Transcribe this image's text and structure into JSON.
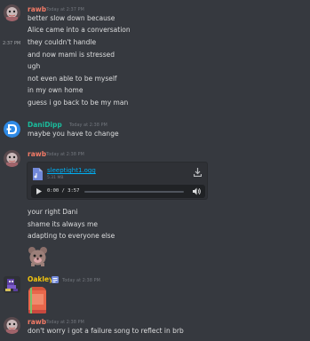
{
  "messages": [
    {
      "username": "rawb",
      "user_color": "#f47b67",
      "timestamp": "Today at 2:37 PM",
      "hover_timestamp": "2:37 PM",
      "lines": [
        "better slow down because",
        "Alice came into a conversation",
        "they couldn't handle",
        "and now mami is stressed",
        "ugh",
        "not even able to be myself",
        "in my own home",
        "guess i go back to be my man"
      ]
    },
    {
      "username": "DaniDipp",
      "user_color": "#1abc9c",
      "timestamp": "Today at 2:38 PM",
      "lines": [
        "maybe you have to change"
      ]
    },
    {
      "username": "rawb",
      "user_color": "#f47b67",
      "timestamp": "Today at 2:38 PM",
      "attachment": {
        "file_name": "sleeptight1.ogg",
        "file_size": "5.31 MB",
        "time": "0:00 / 3:57"
      },
      "lines": [
        "your right Dani",
        "shame its always me",
        "adapting to everyone else"
      ],
      "sticker": "bear-sticker"
    },
    {
      "username": "Oakley",
      "user_color": "#f1c40f",
      "timestamp": "Today at 2:38 PM"
    },
    {
      "username": "rawb",
      "user_color": "#f47b67",
      "timestamp": "Today at 2:38 PM",
      "lines": [
        "don't worry i got a failure song to reflect in brb"
      ]
    }
  ],
  "colors": {
    "background": "#36393f",
    "link": "#00b0f4",
    "muted": "#72767d"
  }
}
